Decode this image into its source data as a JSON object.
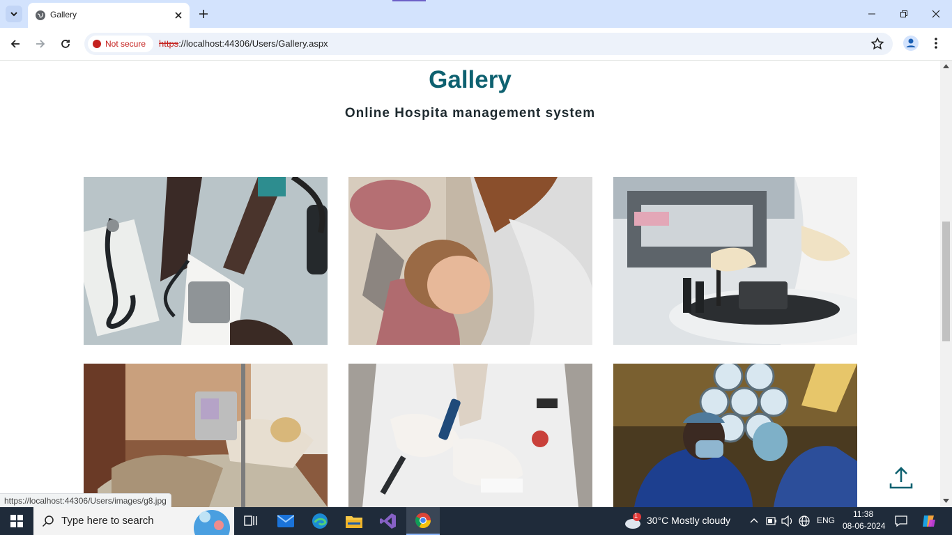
{
  "browser": {
    "tab_title": "Gallery",
    "security_label": "Not secure",
    "url_scheme": "https",
    "url_rest": "://localhost:44306/Users/Gallery.aspx",
    "status_url": "https://localhost:44306/Users/images/g8.jpg"
  },
  "page": {
    "title": "Gallery",
    "subtitle": "Online Hospita management system"
  },
  "gallery": [
    {
      "name": "doctor-blood-pressure-photo"
    },
    {
      "name": "dentist-patient-photo"
    },
    {
      "name": "lab-centrifuge-photo"
    },
    {
      "name": "hospital-bed-iv-photo"
    },
    {
      "name": "lab-pipette-photo"
    },
    {
      "name": "surgery-team-photo"
    }
  ],
  "taskbar": {
    "search_placeholder": "Type here to search",
    "weather": "30°C  Mostly cloudy",
    "language": "ENG",
    "time": "11:38",
    "date": "08-06-2024",
    "notification_count": "1"
  },
  "colors": {
    "title": "#0e6170",
    "subtitle": "#1e2a2f",
    "tabstrip": "#d3e3fd",
    "taskbar": "#1f2b3a"
  }
}
